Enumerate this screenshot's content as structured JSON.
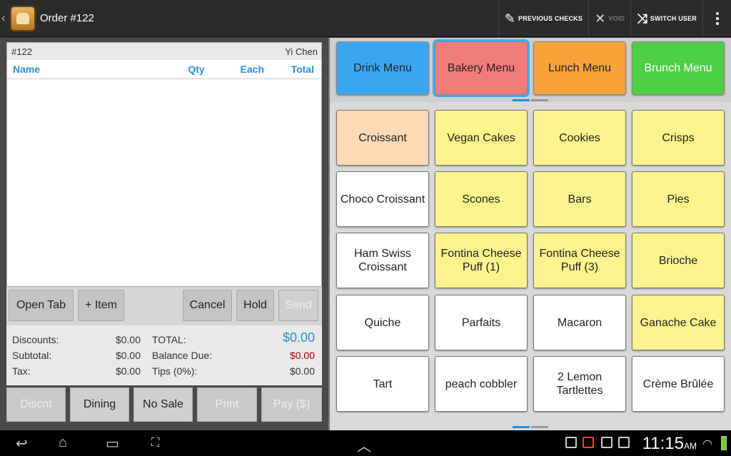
{
  "titlebar": {
    "order_title": "Order #122",
    "previous_checks": "PREVIOUS CHECKS",
    "void": "VOID",
    "switch_user": "SWITCH USER"
  },
  "receipt": {
    "order_no": "#122",
    "server": "Yi Chen",
    "col_name": "Name",
    "col_qty": "Qty",
    "col_each": "Each",
    "col_total": "Total"
  },
  "actions": {
    "open_tab": "Open Tab",
    "add_item": "+ Item",
    "cancel": "Cancel",
    "hold": "Hold",
    "send": "Send"
  },
  "totals": {
    "discounts_label": "Discounts:",
    "discounts_value": "$0.00",
    "subtotal_label": "Subtotal:",
    "subtotal_value": "$0.00",
    "tax_label": "Tax:",
    "tax_value": "$0.00",
    "total_label": "TOTAL:",
    "total_value": "$0.00",
    "balance_label": "Balance Due:",
    "balance_value": "$0.00",
    "tips_label": "Tips (0%):",
    "tips_value": "$0.00"
  },
  "bottom": {
    "discount": "Discnt",
    "dining": "Dining",
    "no_sale": "No Sale",
    "print": "Print",
    "pay": "Pay ($)"
  },
  "menus": [
    {
      "label": "Drink Menu",
      "color": "#3aa6f2"
    },
    {
      "label": "Bakery Menu",
      "color": "#f07b7b"
    },
    {
      "label": "Lunch Menu",
      "color": "#f9a23a"
    },
    {
      "label": "Brunch Menu",
      "color": "#4ccf44"
    }
  ],
  "items": [
    {
      "label": "Croissant",
      "color": "#fdd9b6"
    },
    {
      "label": "Vegan Cakes",
      "color": "#fbf48c"
    },
    {
      "label": "Cookies",
      "color": "#fbf48c"
    },
    {
      "label": "Crisps",
      "color": "#fbf48c"
    },
    {
      "label": "Choco Croissant",
      "color": "#ffffff"
    },
    {
      "label": "Scones",
      "color": "#fbf48c"
    },
    {
      "label": "Bars",
      "color": "#fbf48c"
    },
    {
      "label": "Pies",
      "color": "#fbf48c"
    },
    {
      "label": "Ham Swiss Croissant",
      "color": "#ffffff"
    },
    {
      "label": "Fontina Cheese Puff (1)",
      "color": "#fbf48c"
    },
    {
      "label": "Fontina Cheese Puff (3)",
      "color": "#fbf48c"
    },
    {
      "label": "Brioche",
      "color": "#fbf48c"
    },
    {
      "label": "Quiche",
      "color": "#ffffff"
    },
    {
      "label": "Parfaits",
      "color": "#ffffff"
    },
    {
      "label": "Macaron",
      "color": "#ffffff"
    },
    {
      "label": "Ganache Cake",
      "color": "#fbf48c"
    },
    {
      "label": "Tart",
      "color": "#ffffff"
    },
    {
      "label": "peach cobbler",
      "color": "#ffffff"
    },
    {
      "label": "2 Lemon Tartlettes",
      "color": "#ffffff"
    },
    {
      "label": "Crème Brûlée",
      "color": "#ffffff"
    }
  ],
  "status": {
    "time": "11:15",
    "ampm": "AM"
  }
}
